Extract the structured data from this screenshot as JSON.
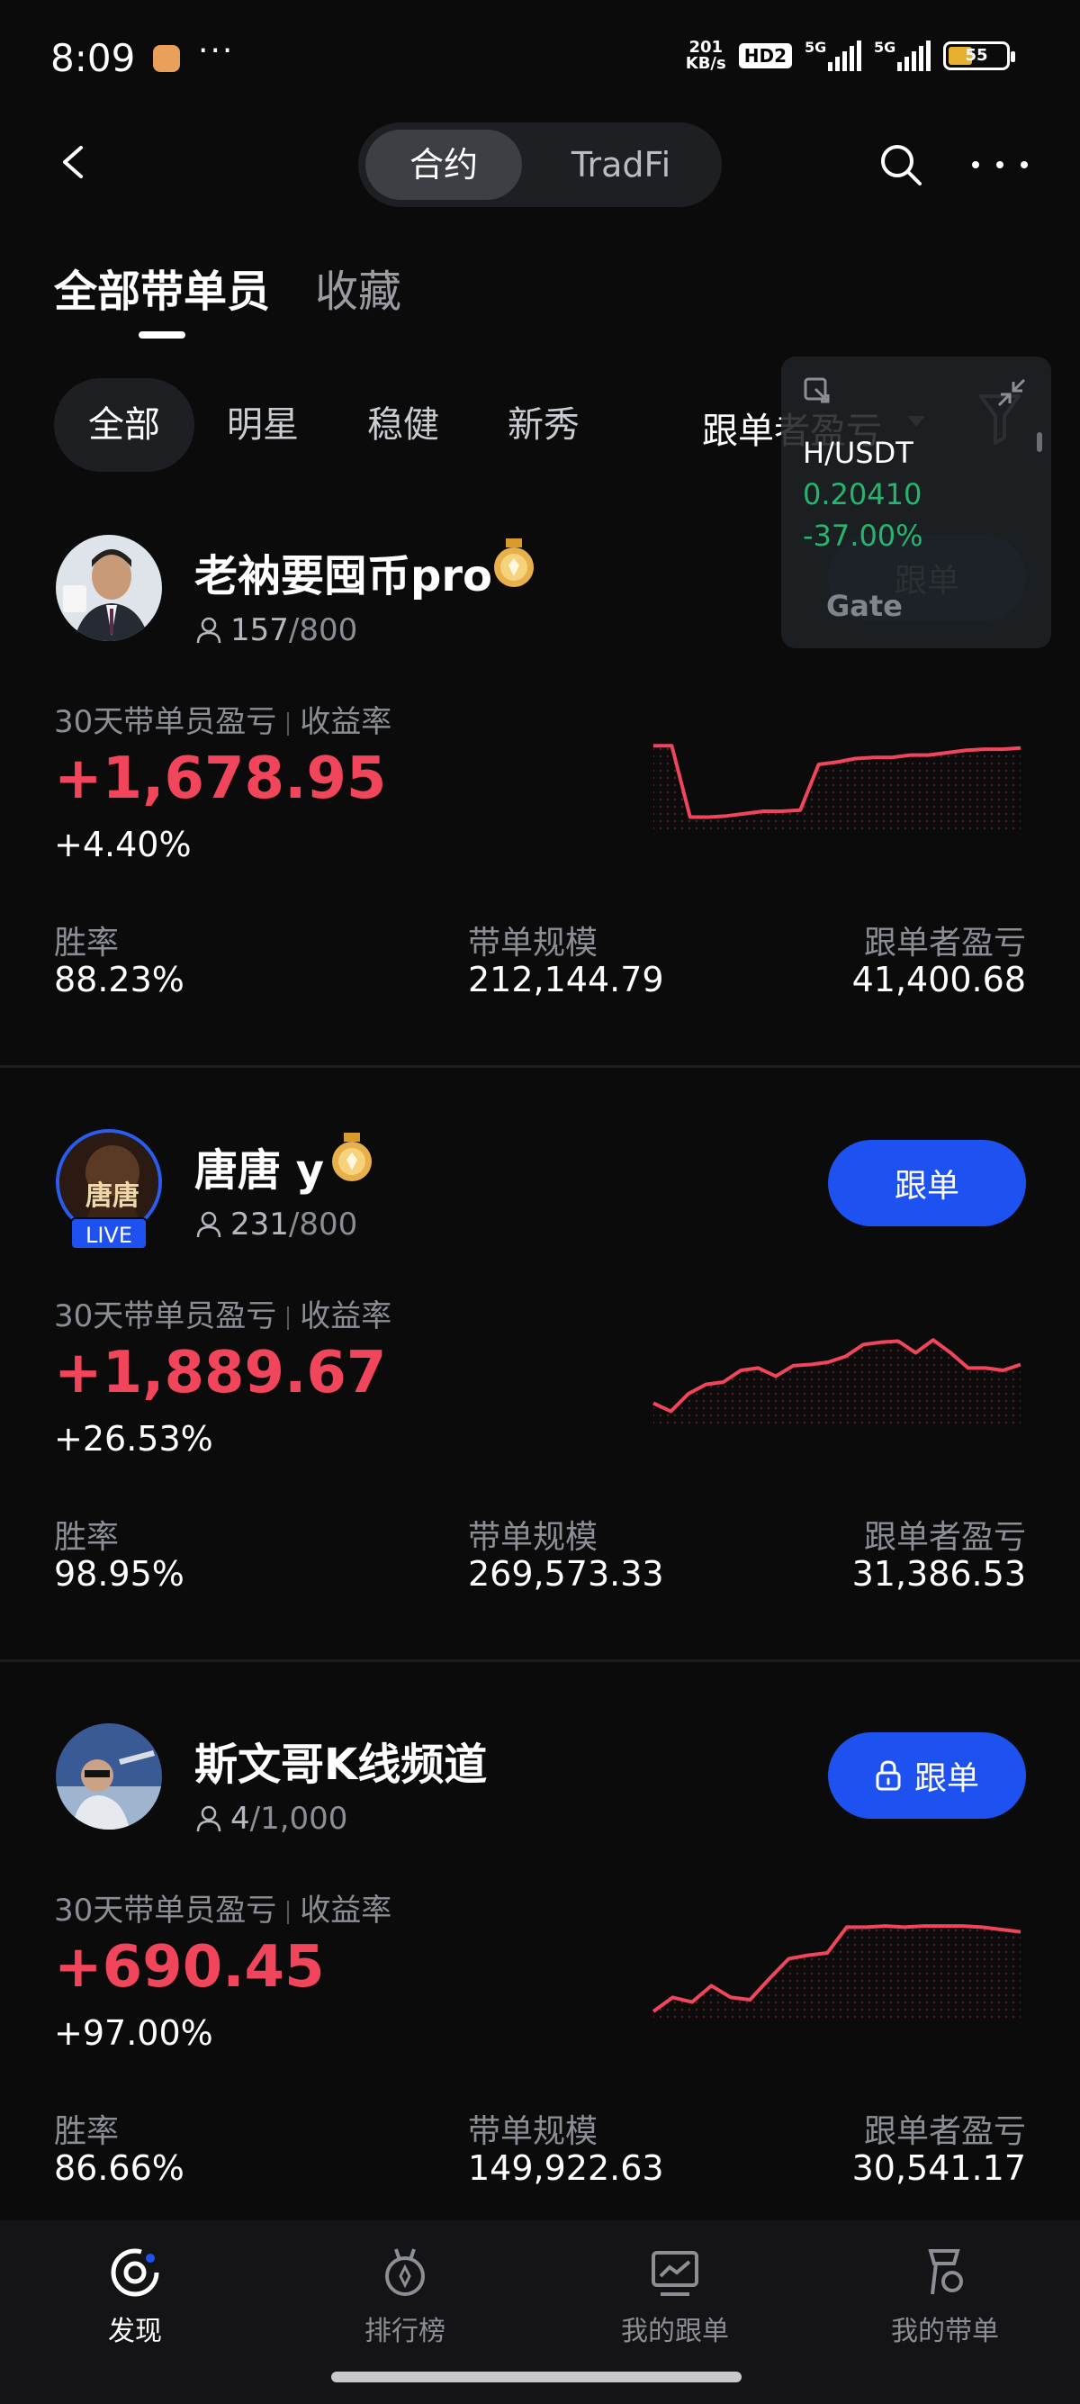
{
  "status_bar": {
    "time": "8:09",
    "dots": "···",
    "net_speed_top": "201",
    "net_speed_bottom": "KB/s",
    "hd": "HD2",
    "signal1": "5G",
    "signal2": "5G",
    "battery": "55"
  },
  "header": {
    "segments": [
      "合约",
      "TradFi"
    ]
  },
  "tabs": {
    "all": "全部带单员",
    "favorites": "收藏"
  },
  "filters": {
    "chips": [
      "全部",
      "明星",
      "稳健",
      "新秀"
    ],
    "sort": "跟单者盈亏"
  },
  "ticker": {
    "pair": "H/USDT",
    "price": "0.20410",
    "change": "-37.00%",
    "brand": "Gate"
  },
  "traders": [
    {
      "name": "老衲要囤币pro",
      "followers": "157",
      "followers_max": "/800",
      "pnl_label": "30天带单员盈亏",
      "roi_label": "收益率",
      "pnl": "+1,678.95",
      "roi": "+4.40%",
      "button": "跟单",
      "stats": {
        "win_rate_label": "胜率",
        "win_rate": "88.23%",
        "aum_label": "带单规模",
        "aum": "212,144.79",
        "follower_pnl_label": "跟单者盈亏",
        "follower_pnl": "41,400.68"
      },
      "spark": [
        0.66,
        0.66,
        0.05,
        0.05,
        0.06,
        0.08,
        0.1,
        0.1,
        0.11,
        0.5,
        0.52,
        0.55,
        0.56,
        0.56,
        0.58,
        0.58,
        0.6,
        0.62,
        0.63,
        0.63,
        0.64
      ]
    },
    {
      "name": "唐唐 y",
      "live": "LIVE",
      "followers": "231",
      "followers_max": "/800",
      "pnl_label": "30天带单员盈亏",
      "roi_label": "收益率",
      "pnl": "+1,889.67",
      "roi": "+26.53%",
      "button": "跟单",
      "stats": {
        "win_rate_label": "胜率",
        "win_rate": "98.95%",
        "aum_label": "带单规模",
        "aum": "269,573.33",
        "follower_pnl_label": "跟单者盈亏",
        "follower_pnl": "31,386.53"
      },
      "spark": [
        0.12,
        0.05,
        0.2,
        0.28,
        0.3,
        0.4,
        0.42,
        0.35,
        0.44,
        0.45,
        0.47,
        0.52,
        0.62,
        0.64,
        0.65,
        0.55,
        0.66,
        0.55,
        0.42,
        0.42,
        0.4,
        0.45
      ]
    },
    {
      "name": "斯文哥K线频道",
      "followers": "4",
      "followers_max": "/1,000",
      "pnl_label": "30天带单员盈亏",
      "roi_label": "收益率",
      "pnl": "+690.45",
      "roi": "+97.00%",
      "button": "跟单",
      "stats": {
        "win_rate_label": "胜率",
        "win_rate": "86.66%",
        "aum_label": "带单规模",
        "aum": "149,922.63",
        "follower_pnl_label": "跟单者盈亏",
        "follower_pnl": "30,541.17"
      },
      "spark": [
        0.0,
        0.12,
        0.08,
        0.22,
        0.12,
        0.1,
        0.28,
        0.45,
        0.48,
        0.5,
        0.72,
        0.72,
        0.73,
        0.72,
        0.73,
        0.73,
        0.73,
        0.72,
        0.7,
        0.68
      ]
    }
  ],
  "bottom_nav": [
    "发现",
    "排行榜",
    "我的跟单",
    "我的带单"
  ],
  "colors": {
    "accent": "#1e52f0",
    "profit": "#f0455b",
    "ticker_green": "#26b46e"
  }
}
